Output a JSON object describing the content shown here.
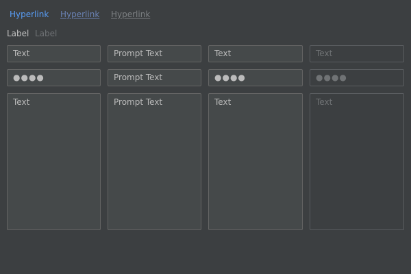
{
  "hyperlinks": {
    "normal": "Hyperlink",
    "visited": "Hyperlink",
    "disabled": "Hyperlink"
  },
  "labels": {
    "normal": "Label",
    "disabled": "Label"
  },
  "text_fields": {
    "normal_value": "Text",
    "prompt_placeholder": "Prompt Text",
    "editable_value": "Text",
    "disabled_value": "Text"
  },
  "password_fields": {
    "normal_value": "●●●●",
    "prompt_placeholder": "Prompt Text",
    "editable_value": "●●●●",
    "disabled_value": "●●●●"
  },
  "text_areas": {
    "normal_value": "Text",
    "prompt_placeholder": "Prompt Text",
    "editable_value": "Text",
    "disabled_value": "Text"
  },
  "colors": {
    "background": "#3c3f41",
    "field_background": "#45494a",
    "field_border": "#646464",
    "text": "#bbbbbb",
    "disabled_text": "#707375",
    "link": "#589df6",
    "visited_link": "#6a82b4"
  }
}
